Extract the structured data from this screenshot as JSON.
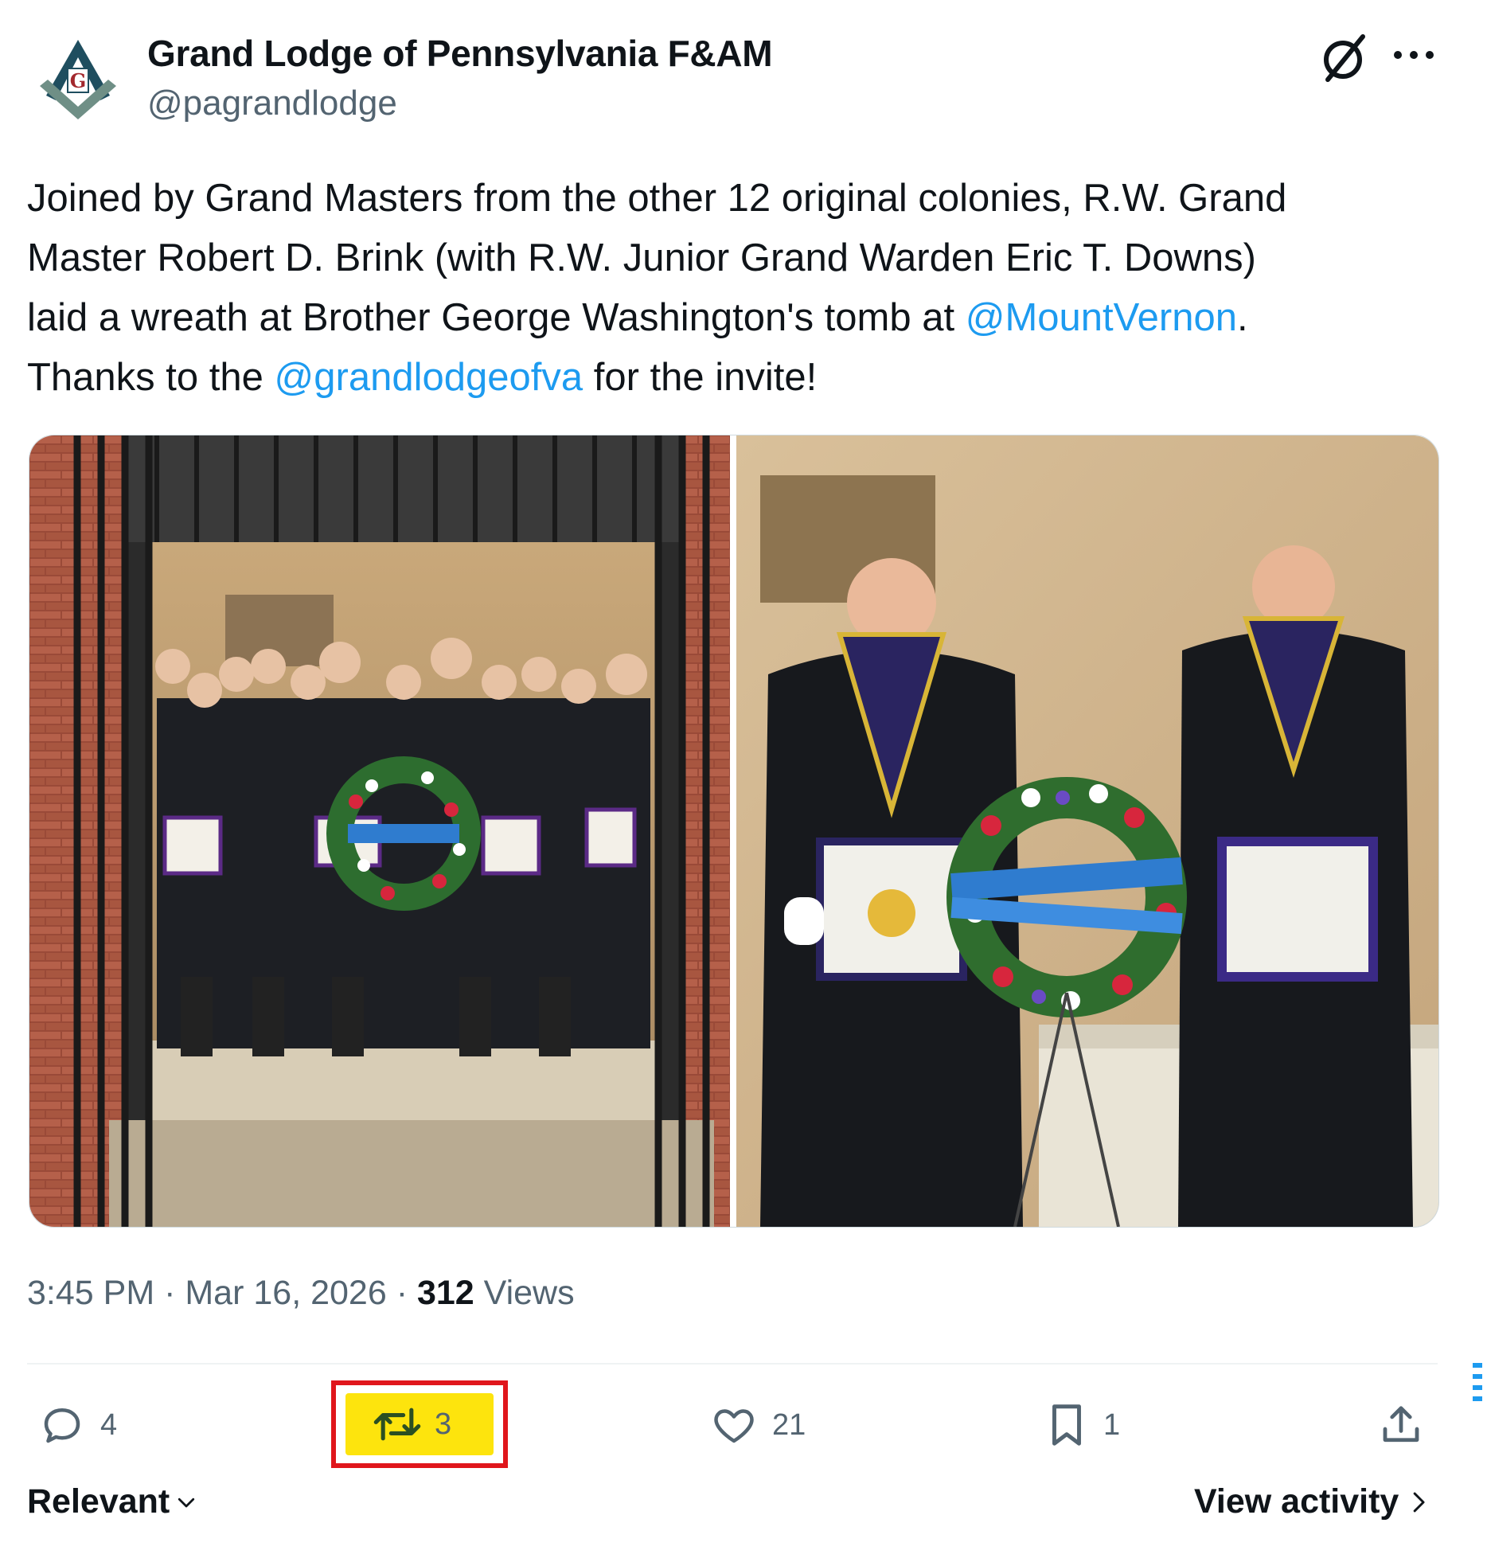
{
  "author": {
    "name": "Grand Lodge of Pennsylvania F&AM",
    "handle": "@pagrandlodge",
    "logo_letter": "G"
  },
  "tweet": {
    "line1": "Joined by Grand Masters from the other 12 original colonies, R.W. Grand",
    "line2": "Master Robert D. Brink (with R.W. Junior Grand Warden Eric T. Downs)",
    "line3_before": "laid a wreath at Brother George Washington's tomb at ",
    "line3_mention": "@MountVernon",
    "line3_after": ".",
    "line4_before": "Thanks to the ",
    "line4_mention": "@grandlodgeofva",
    "line4_after": " for the invite!"
  },
  "meta": {
    "time": "3:45 PM",
    "sep1": " · ",
    "date": "Mar 16, 2026",
    "sep2": " · ",
    "views_count": "312",
    "views_label": " Views"
  },
  "actions": {
    "reply_count": "4",
    "retweet_count": "3",
    "like_count": "21",
    "bookmark_count": "1"
  },
  "footer": {
    "sort_label": "Relevant",
    "activity_label": "View activity"
  },
  "icons": {
    "grok": "grok-icon",
    "more": "more-icon",
    "reply": "reply-icon",
    "retweet": "retweet-icon",
    "like": "heart-icon",
    "bookmark": "bookmark-icon",
    "share": "share-icon"
  },
  "colors": {
    "link": "#1d9bf0",
    "secondary_text": "#536471",
    "highlight": "#fde40d",
    "highlight_border": "#e0161c"
  }
}
